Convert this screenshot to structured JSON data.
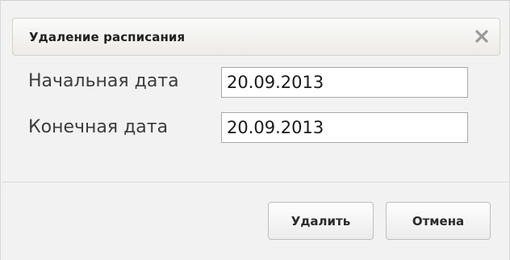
{
  "dialog": {
    "title": "Удаление расписания",
    "close_icon": "close-icon"
  },
  "form": {
    "start_date": {
      "label": "Начальная дата",
      "value": "20.09.2013"
    },
    "end_date": {
      "label": "Конечная дата",
      "value": "20.09.2013"
    }
  },
  "buttons": {
    "delete_label": "Удалить",
    "cancel_label": "Отмена"
  }
}
